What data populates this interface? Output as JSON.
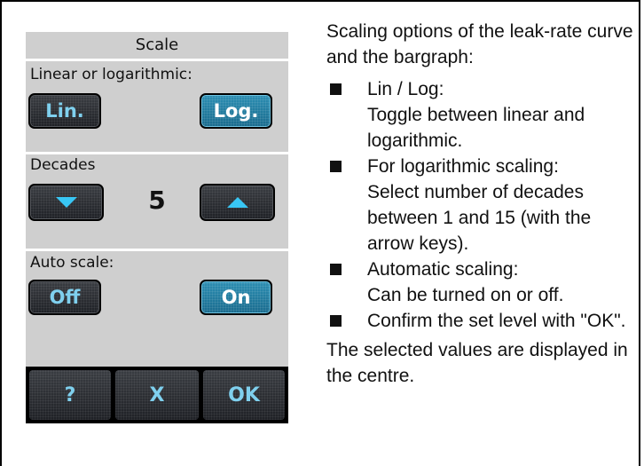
{
  "panel": {
    "title": "Scale",
    "linear_log_label": "Linear or logarithmic:",
    "lin_button": "Lin.",
    "log_button": "Log.",
    "decades_label": "Decades",
    "decades_value": "5",
    "decrease_icon": "triangle-down-icon",
    "increase_icon": "triangle-up-icon",
    "auto_scale_label": "Auto scale:",
    "off_button": "Off",
    "on_button": "On",
    "help_button": "?",
    "cancel_button": "X",
    "ok_button": "OK",
    "selected_scale": "Log.",
    "selected_auto_scale": "On"
  },
  "colors": {
    "panel_background": "#cfcfcf",
    "button_dark": "#2a2d32",
    "button_active": "#2284aa",
    "button_text": "#7fd0ee"
  },
  "description": {
    "intro": "Scaling options of the leak-rate curve and the bargraph:",
    "bullets": [
      {
        "title": "Lin / Log:",
        "text": "Toggle between linear and logarithmic."
      },
      {
        "title": "For logarithmic scaling:",
        "text": "Select number of decades between 1 and 15 (with the arrow keys)."
      },
      {
        "title": "Automatic scaling:",
        "text": "Can be turned on or off."
      },
      {
        "title": "",
        "text": "Confirm the set level with \"OK\"."
      }
    ],
    "closing": "The selected values are displayed in the centre."
  }
}
